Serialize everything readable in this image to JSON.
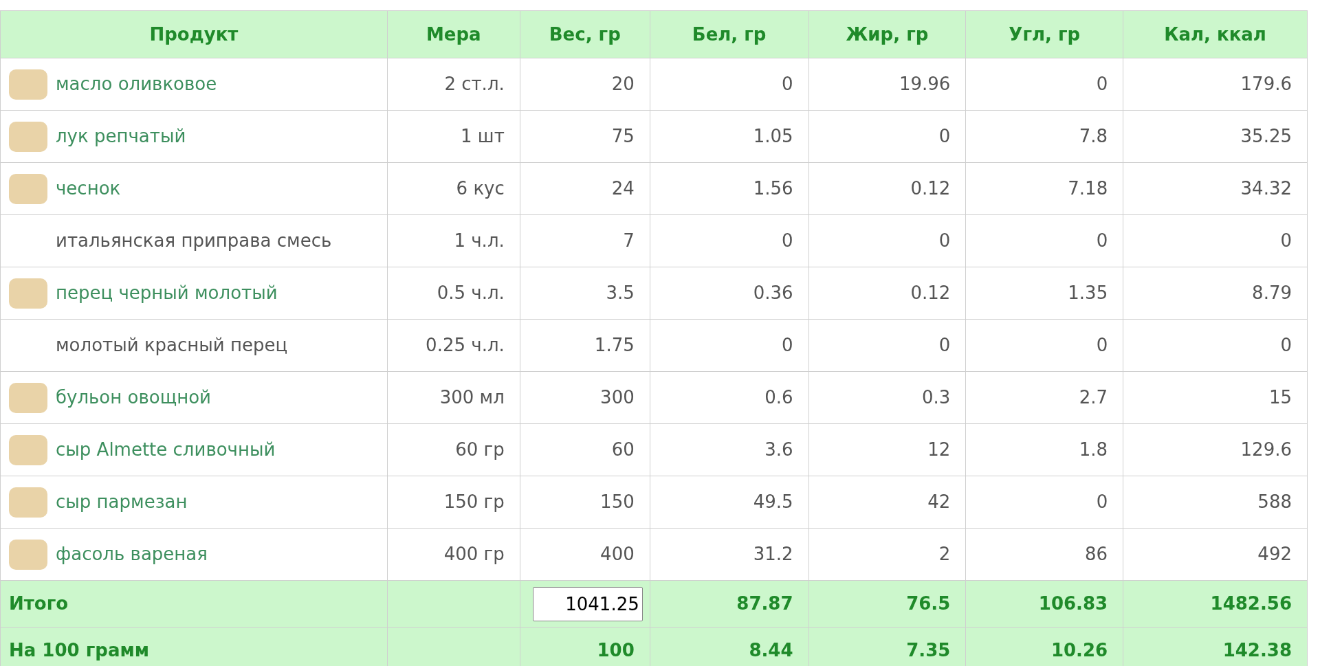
{
  "columns": [
    "Продукт",
    "Мера",
    "Вес, гр",
    "Бел, гр",
    "Жир, гр",
    "Угл, гр",
    "Кал, ккал"
  ],
  "rows": [
    {
      "kind": "link",
      "product": "масло оливковое",
      "measure": "2 ст.л.",
      "weight": "20",
      "protein": "0",
      "fat": "19.96",
      "carbs": "0",
      "kcal": "179.6"
    },
    {
      "kind": "link",
      "product": "лук репчатый",
      "measure": "1 шт",
      "weight": "75",
      "protein": "1.05",
      "fat": "0",
      "carbs": "7.8",
      "kcal": "35.25"
    },
    {
      "kind": "link",
      "product": "чеснок",
      "measure": "6 кус",
      "weight": "24",
      "protein": "1.56",
      "fat": "0.12",
      "carbs": "7.18",
      "kcal": "34.32"
    },
    {
      "kind": "plain",
      "product": "итальянская приправа смесь",
      "measure": "1 ч.л.",
      "weight": "7",
      "protein": "0",
      "fat": "0",
      "carbs": "0",
      "kcal": "0"
    },
    {
      "kind": "link",
      "product": "перец черный молотый",
      "measure": "0.5 ч.л.",
      "weight": "3.5",
      "protein": "0.36",
      "fat": "0.12",
      "carbs": "1.35",
      "kcal": "8.79"
    },
    {
      "kind": "plain",
      "product": "молотый красный перец",
      "measure": "0.25 ч.л.",
      "weight": "1.75",
      "protein": "0",
      "fat": "0",
      "carbs": "0",
      "kcal": "0"
    },
    {
      "kind": "link",
      "product": "бульон овощной",
      "measure": "300 мл",
      "weight": "300",
      "protein": "0.6",
      "fat": "0.3",
      "carbs": "2.7",
      "kcal": "15"
    },
    {
      "kind": "link",
      "product": "сыр Almette сливочный",
      "measure": "60 гр",
      "weight": "60",
      "protein": "3.6",
      "fat": "12",
      "carbs": "1.8",
      "kcal": "129.6"
    },
    {
      "kind": "link",
      "product": "сыр пармезан",
      "measure": "150 гр",
      "weight": "150",
      "protein": "49.5",
      "fat": "42",
      "carbs": "0",
      "kcal": "588"
    },
    {
      "kind": "link",
      "product": "фасоль вареная",
      "measure": "400 гр",
      "weight": "400",
      "protein": "31.2",
      "fat": "2",
      "carbs": "86",
      "kcal": "492"
    }
  ],
  "totals": [
    {
      "kind": "input",
      "label": "Итого",
      "weight": "1041.25",
      "protein": "87.87",
      "fat": "76.5",
      "carbs": "106.83",
      "kcal": "1482.56"
    },
    {
      "kind": "text",
      "label": "На 100 грамм",
      "weight": "100",
      "protein": "8.44",
      "fat": "7.35",
      "carbs": "10.26",
      "kcal": "142.38"
    }
  ]
}
